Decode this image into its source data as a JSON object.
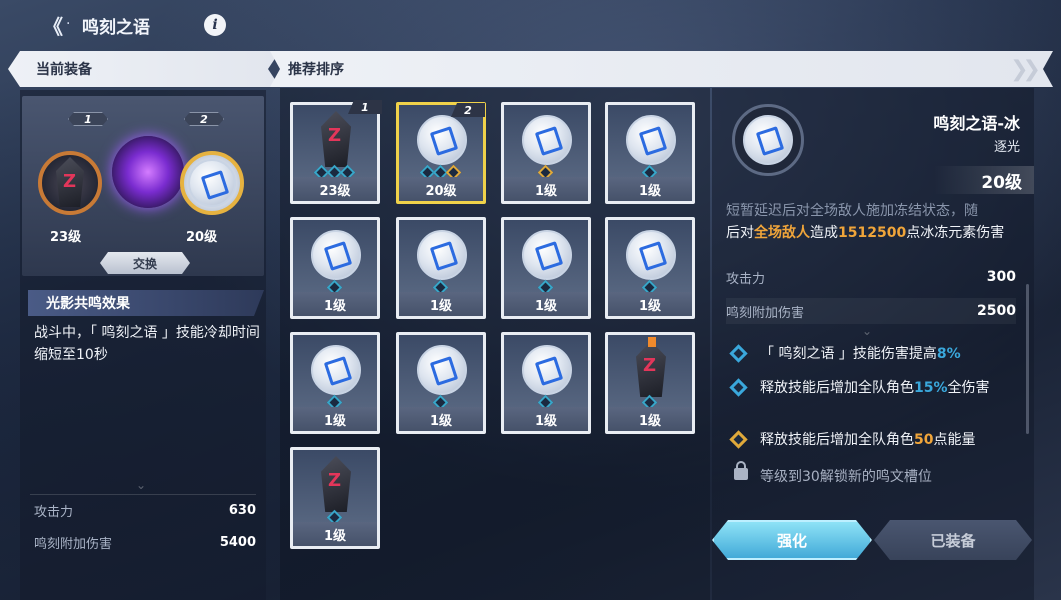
{
  "header": {
    "title": "鸣刻之语",
    "back_label": "《",
    "dot": "·",
    "info_label": "i"
  },
  "sections": {
    "current_equipment": "当前装备",
    "recommended_sort": "推荐排序"
  },
  "left": {
    "slot1_tag": "1",
    "slot2_tag": "2",
    "slot1_level": "23级",
    "slot2_level": "20级",
    "swap_label": "交换",
    "resonance_title": "光影共鸣效果",
    "resonance_text": "战斗中，「 鸣刻之语 」技能冷却时间缩短至10秒",
    "stats": [
      {
        "k": "攻击力",
        "v": "630"
      },
      {
        "k": "鸣刻附加伤害",
        "v": "5400"
      }
    ]
  },
  "grid": {
    "items": [
      {
        "type": "crystal",
        "level": "23级",
        "tag": "1",
        "runes": [
          "blue",
          "blue",
          "blue"
        ]
      },
      {
        "type": "gem",
        "level": "20级",
        "tag": "2",
        "runes": [
          "blue",
          "blue",
          "gold"
        ],
        "selected": true
      },
      {
        "type": "gem",
        "level": "1级",
        "tag": "",
        "runes": [
          "gold"
        ]
      },
      {
        "type": "gem",
        "level": "1级",
        "tag": "",
        "runes": [
          "blue"
        ]
      },
      {
        "type": "gem",
        "level": "1级",
        "tag": "",
        "runes": [
          "blue"
        ]
      },
      {
        "type": "gem",
        "level": "1级",
        "tag": "",
        "runes": [
          "blue"
        ]
      },
      {
        "type": "gem",
        "level": "1级",
        "tag": "",
        "runes": [
          "blue"
        ]
      },
      {
        "type": "gem",
        "level": "1级",
        "tag": "",
        "runes": [
          "blue"
        ]
      },
      {
        "type": "gem",
        "level": "1级",
        "tag": "",
        "runes": [
          "blue"
        ]
      },
      {
        "type": "gem",
        "level": "1级",
        "tag": "",
        "runes": [
          "blue"
        ]
      },
      {
        "type": "gem",
        "level": "1级",
        "tag": "",
        "runes": [
          "blue"
        ]
      },
      {
        "type": "crystal",
        "level": "1级",
        "tag": "",
        "runes": [
          "blue"
        ],
        "flag": true
      },
      {
        "type": "crystal",
        "level": "1级",
        "tag": "",
        "runes": [
          "blue"
        ]
      }
    ]
  },
  "detail": {
    "name": "鸣刻之语-冰",
    "subtitle": "逐光",
    "level": "20级",
    "desc_top": "短暂延迟后对全场敌人施加冻结状态，随",
    "desc_a": "后对",
    "desc_b": "全场敌人",
    "desc_c": "造成",
    "desc_d": "1512500",
    "desc_e": "点冰冻元素伤害",
    "stats": [
      {
        "k": "攻击力",
        "v": "300"
      },
      {
        "k": "鸣刻附加伤害",
        "v": "2500"
      }
    ],
    "effects": [
      {
        "pre": "「 鸣刻之语 」技能伤害提高",
        "val": "8%",
        "post": "",
        "color": "blue"
      },
      {
        "pre": "释放技能后增加全队角色",
        "val": "15%",
        "post": "全伤害",
        "color": "blue"
      },
      {
        "pre": "释放技能后增加全队角色",
        "val": "50",
        "post": "点能量",
        "color": "gold"
      }
    ],
    "lock_text": "等级到30解锁新的鸣文槽位",
    "upgrade_label": "强化",
    "equipped_label": "已装备"
  },
  "colors": {
    "accent": "#42aad8",
    "highlight": "#f0a53a",
    "rune_blue": "#3aa8dc",
    "rune_gold": "#e0a93a"
  }
}
